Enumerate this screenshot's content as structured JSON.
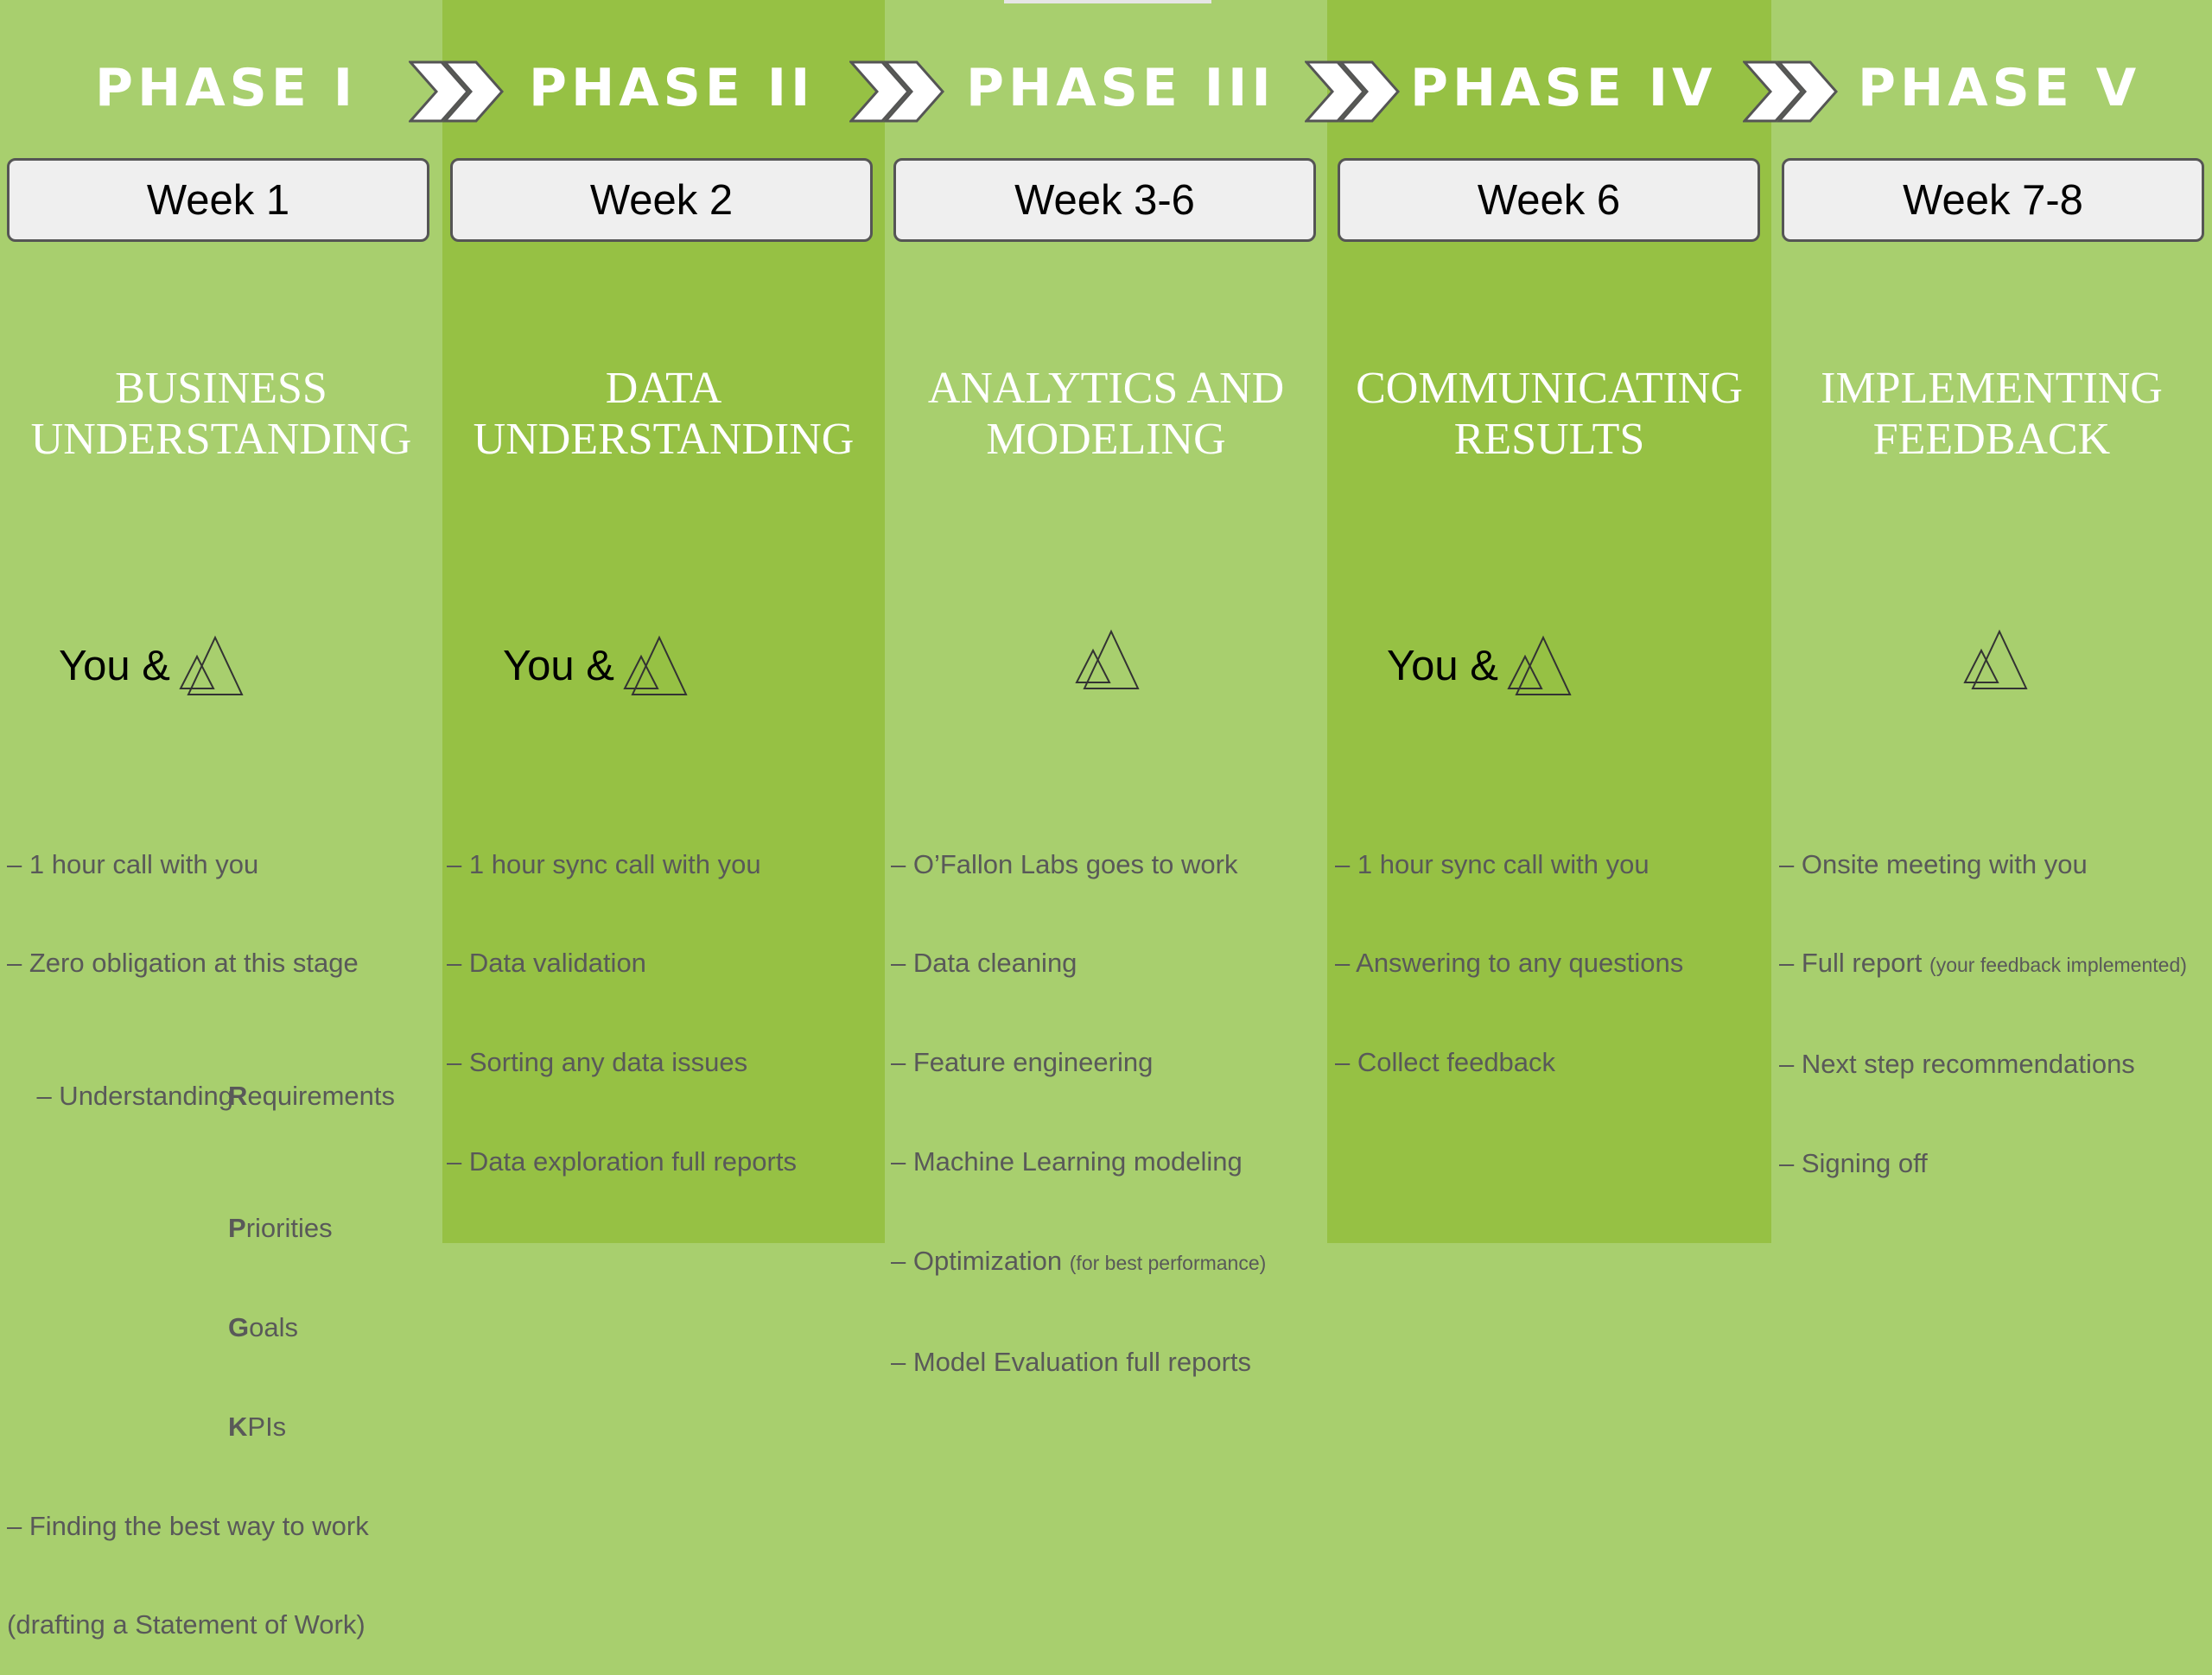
{
  "phases": [
    {
      "phase": "PHASE I",
      "week": "Week 1",
      "title_line1": "BUSINESS",
      "title_line2": "UNDERSTANDING",
      "participants": "You &",
      "items": [
        "– 1 hour call with you",
        "– Zero obligation at this stage",
        "– Understanding",
        "R",
        "equirements",
        "P",
        "riorities",
        "G",
        "oals",
        "K",
        "PIs",
        "– Finding the best way to work",
        "(drafting a Statement of Work)"
      ]
    },
    {
      "phase": "PHASE II",
      "week": "Week 2",
      "title_line1": "DATA",
      "title_line2": "UNDERSTANDING",
      "participants": "You &",
      "items": [
        "– 1 hour sync call with you",
        "– Data validation",
        "– Sorting any data issues",
        "– Data exploration full reports"
      ]
    },
    {
      "phase": "PHASE III",
      "week": "Week 3-6",
      "title_line1": "ANALYTICS AND",
      "title_line2": "MODELING",
      "participants": "",
      "items": [
        "– O’Fallon Labs goes to work",
        "– Data cleaning",
        "– Feature engineering",
        "– Machine Learning modeling",
        "– Optimization",
        "(for best performance)",
        "– Model Evaluation full reports"
      ]
    },
    {
      "phase": "PHASE IV",
      "week": "Week 6",
      "title_line1": "COMMUNICATING",
      "title_line2": "RESULTS",
      "participants": "You &",
      "items": [
        "– 1 hour sync call with you",
        "– Answering to any questions",
        "– Collect feedback"
      ]
    },
    {
      "phase": "PHASE V",
      "week": "Week 7-8",
      "title_line1": "IMPLEMENTING",
      "title_line2": "FEEDBACK",
      "participants": "",
      "items": [
        "– Onsite meeting with you",
        "– Full report",
        "(your feedback implemented)",
        "– Next step recommendations",
        "– Signing off"
      ]
    }
  ],
  "colors": {
    "light_column": "#a8cf6e",
    "dark_column": "#96c144",
    "heading_text": "#ffffff",
    "list_text": "#595959",
    "week_box": "#efefef"
  },
  "icons": [
    "chevron-arrow-icon",
    "triangle-logo-icon"
  ]
}
